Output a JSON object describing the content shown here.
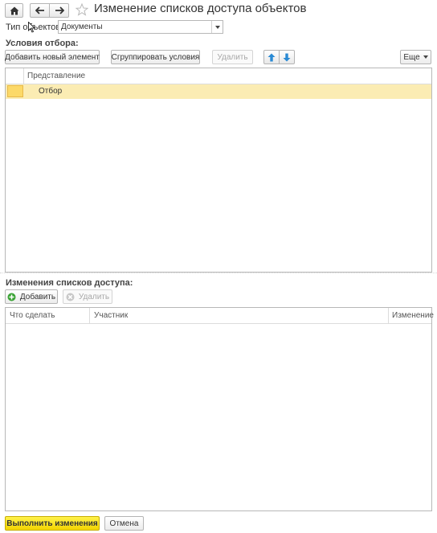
{
  "window": {
    "title": "Изменение списков доступа объектов"
  },
  "object_type": {
    "label": "Тип объектов:",
    "value": "Документы"
  },
  "conditions": {
    "section_label": "Условия отбора:",
    "add_button": "Добавить новый элемент",
    "group_button": "Сгруппировать условия",
    "delete_button": "Удалить",
    "more_button": "Еще",
    "column_header": "Представление",
    "rows": [
      {
        "label": "Отбор"
      }
    ]
  },
  "access_changes": {
    "section_label": "Изменения списков доступа:",
    "add_button": "Добавить",
    "delete_button": "Удалить",
    "columns": [
      "Что сделать",
      "Участник",
      "Изменение"
    ]
  },
  "footer": {
    "execute_button": "Выполнить изменения",
    "cancel_button": "Отмена"
  },
  "colors": {
    "accent_yellow": "#f5d800",
    "selection_row": "#fbecb3",
    "arrow_blue": "#2a8ad4",
    "add_green": "#3aa335"
  }
}
